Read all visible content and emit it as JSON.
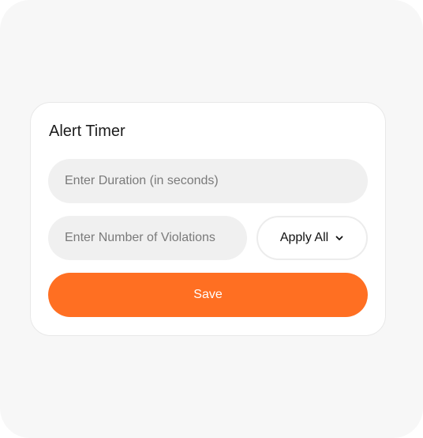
{
  "dialog": {
    "title": "Alert Timer",
    "duration_input": {
      "value": "",
      "placeholder": "Enter Duration (in seconds)"
    },
    "violations_input": {
      "value": "",
      "placeholder": "Enter Number of Violations"
    },
    "apply_select": {
      "selected": "Apply All",
      "icon": "chevron-down-icon"
    },
    "save_label": "Save"
  },
  "colors": {
    "background": "#f7f7f7",
    "card": "#ffffff",
    "input_fill": "#f0f0f0",
    "accent": "#ff6f22"
  }
}
